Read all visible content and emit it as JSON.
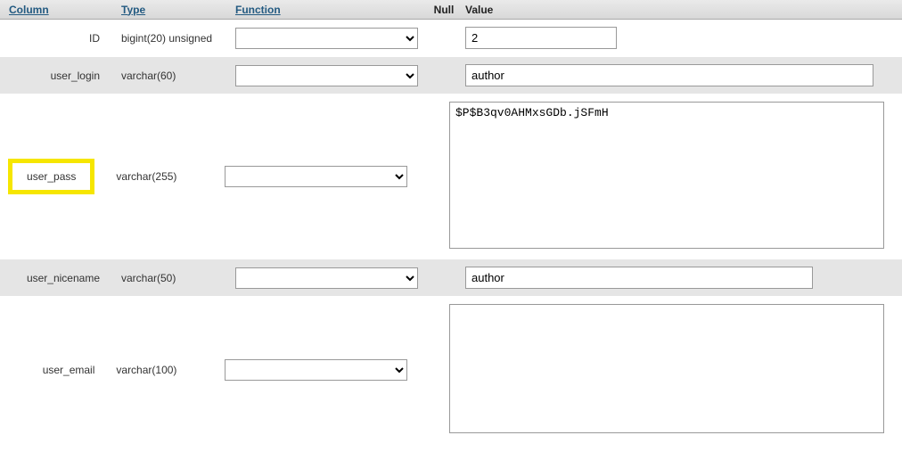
{
  "headers": {
    "column": "Column",
    "type": "Type",
    "function": "Function",
    "null": "Null",
    "value": "Value"
  },
  "rows": [
    {
      "column": "ID",
      "type": "bigint(20) unsigned",
      "value": "2",
      "input": "short",
      "highlighted": false,
      "parity": "odd"
    },
    {
      "column": "user_login",
      "type": "varchar(60)",
      "value": "author",
      "input": "long",
      "highlighted": false,
      "parity": "even"
    },
    {
      "column": "user_pass",
      "type": "varchar(255)",
      "value": "$P$B3qv0AHMxsGDb.jSFmH",
      "input": "textarea-pass",
      "highlighted": true,
      "parity": "odd"
    },
    {
      "column": "user_nicename",
      "type": "varchar(50)",
      "value": "author",
      "input": "medium",
      "highlighted": false,
      "parity": "even"
    },
    {
      "column": "user_email",
      "type": "varchar(100)",
      "value": "",
      "input": "textarea-email",
      "highlighted": false,
      "parity": "odd"
    }
  ]
}
